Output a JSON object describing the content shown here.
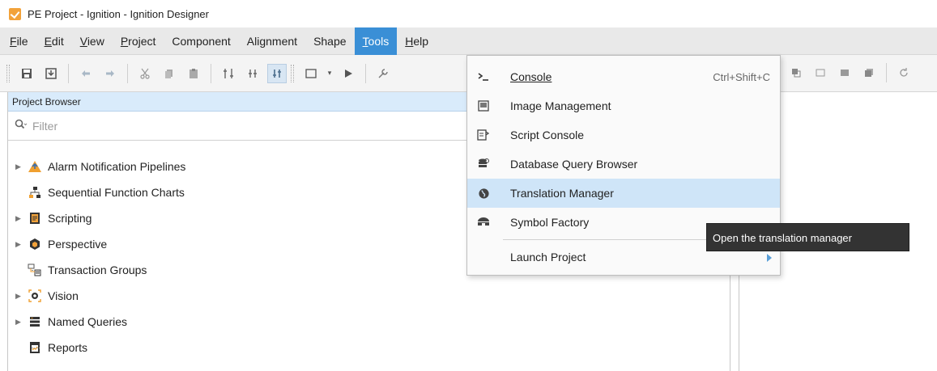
{
  "window": {
    "title": "PE Project - Ignition - Ignition Designer"
  },
  "menubar": {
    "items": [
      {
        "label": "File"
      },
      {
        "label": "Edit"
      },
      {
        "label": "View"
      },
      {
        "label": "Project"
      },
      {
        "label": "Component"
      },
      {
        "label": "Alignment"
      },
      {
        "label": "Shape"
      },
      {
        "label": "Tools"
      },
      {
        "label": "Help"
      }
    ],
    "active": "Tools"
  },
  "project_browser": {
    "title": "Project Browser",
    "filter_placeholder": "Filter",
    "items": [
      {
        "label": "Alarm Notification Pipelines",
        "icon": "alarm-pipeline-icon"
      },
      {
        "label": "Sequential Function Charts",
        "icon": "sfc-icon"
      },
      {
        "label": "Scripting",
        "icon": "scripting-icon"
      },
      {
        "label": "Perspective",
        "icon": "perspective-icon"
      },
      {
        "label": "Transaction Groups",
        "icon": "transaction-groups-icon"
      },
      {
        "label": "Vision",
        "icon": "vision-icon"
      },
      {
        "label": "Named Queries",
        "icon": "named-queries-icon"
      },
      {
        "label": "Reports",
        "icon": "reports-icon"
      }
    ]
  },
  "tools_menu": {
    "items": [
      {
        "label": "Console",
        "shortcut": "Ctrl+Shift+C",
        "icon": "console-icon"
      },
      {
        "label": "Image Management",
        "icon": "image-management-icon"
      },
      {
        "label": "Script Console",
        "icon": "script-console-icon"
      },
      {
        "label": "Database Query Browser",
        "icon": "database-icon"
      },
      {
        "label": "Translation Manager",
        "icon": "globe-icon"
      },
      {
        "label": "Symbol Factory",
        "icon": "symbol-factory-icon"
      },
      {
        "label": "Launch Project",
        "icon": "submenu-arrow-icon"
      }
    ],
    "highlighted": "Translation Manager"
  },
  "tooltip": {
    "text": "Open the translation manager"
  },
  "colors": {
    "menu_active": "#3a8fd6",
    "highlight": "#cfe5f8",
    "panel_header": "#d9ebfb"
  }
}
